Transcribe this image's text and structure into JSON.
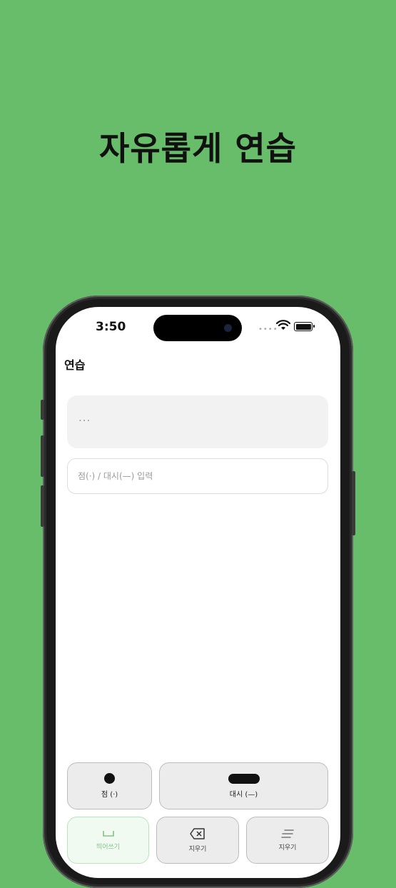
{
  "hero": {
    "title": "자유롭게 연습"
  },
  "status_bar": {
    "time": "3:50",
    "signal": "•••• "
  },
  "nav": {
    "title": "연습"
  },
  "output": {
    "text": "..."
  },
  "input": {
    "placeholder": "점(·) / 대시(—) 입력",
    "value": ""
  },
  "keys": {
    "dot": "점 (·)",
    "dash": "대시 (—)",
    "space": "띄어쓰기",
    "backspace": "지우기",
    "clear": "지우기"
  },
  "colors": {
    "background": "#67bd69",
    "space_accent": "#7fc482"
  }
}
